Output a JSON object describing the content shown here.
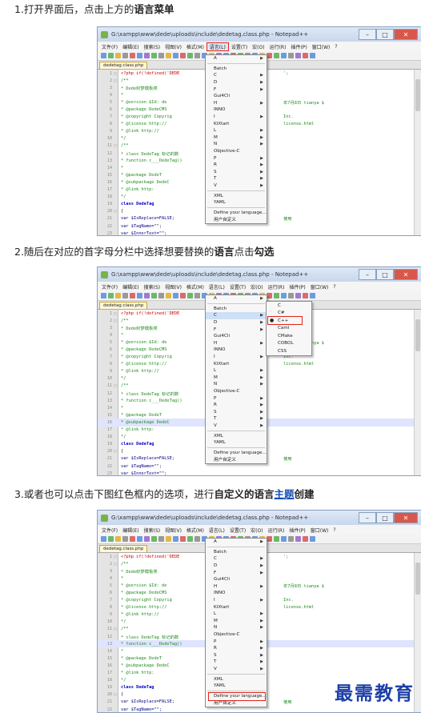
{
  "steps": [
    {
      "pre": "1.打开界面后，点击上方的",
      "bold1": "语言菜单",
      "mid": "",
      "bold2": "",
      "link": "",
      "tail": ""
    },
    {
      "pre": "2.随后在对应的首字母分栏中选择想要替换的",
      "bold1": "语言",
      "mid": "点击",
      "bold2": "勾选",
      "link": "",
      "tail": ""
    },
    {
      "pre": "3.或者也可以点击下图红色框内的选项，进行",
      "bold1": "自定义的语言",
      "mid": "",
      "bold2": "",
      "link": "主题",
      "tail": "创建"
    }
  ],
  "window": {
    "title": "G:\\xampp\\www\\dede\\uploads\\include\\dedetag.class.php - Notepad++",
    "close": "✕",
    "maximize": "□",
    "minimize": "–",
    "menus": [
      "文件(F)",
      "编辑(E)",
      "搜索(S)",
      "视图(V)",
      "格式(M)",
      "语言(L)",
      "设置(T)",
      "宏(O)",
      "运行(R)",
      "插件(P)",
      "窗口(W)",
      "?"
    ],
    "tab": "dedetag.class.php"
  },
  "code": [
    {
      "n": "1",
      "f": "□",
      "t": "<?php   if(!defined('DEDE"
    },
    {
      "n": "2",
      "f": "□",
      "t": "/**"
    },
    {
      "n": "3",
      "f": "",
      "t": " * Dede织梦模板类"
    },
    {
      "n": "4",
      "f": "",
      "t": " *"
    },
    {
      "n": "5",
      "f": "",
      "t": " * @version        $Id: de"
    },
    {
      "n": "6",
      "f": "",
      "t": " * @package        DedeCMS"
    },
    {
      "n": "7",
      "f": "",
      "t": " * @copyright      Copyrig"
    },
    {
      "n": "8",
      "f": "",
      "t": " * @license        http://"
    },
    {
      "n": "9",
      "f": "",
      "t": " * @link           http://"
    },
    {
      "n": "10",
      "f": "",
      "t": " */"
    },
    {
      "n": "11",
      "f": "□",
      "t": "/**"
    },
    {
      "n": "12",
      "f": "",
      "t": " * class DedeTag 标记的数"
    },
    {
      "n": "13",
      "f": "",
      "t": " * function c___DedeTag()"
    },
    {
      "n": "14",
      "f": "",
      "t": " *"
    },
    {
      "n": "15",
      "f": "",
      "t": " * @package        DedeT"
    },
    {
      "n": "16",
      "f": "",
      "t": " * @subpackage     DedeC"
    },
    {
      "n": "17",
      "f": "",
      "t": " * @link           http:"
    },
    {
      "n": "18",
      "f": "",
      "t": " */"
    },
    {
      "n": "19",
      "f": "",
      "t": "class DedeTag"
    },
    {
      "n": "20",
      "f": "□",
      "t": "{"
    },
    {
      "n": "21",
      "f": "",
      "t": "    var $IsReplace=FALSE;"
    },
    {
      "n": "22",
      "f": "",
      "t": "    var $TagName=\"\";"
    },
    {
      "n": "23",
      "f": "",
      "t": "    var $InnerText=\"\";"
    },
    {
      "n": "24",
      "f": "",
      "t": "    var $StartPos=0;"
    },
    {
      "n": "25",
      "f": "",
      "t": "    var $EndPos=0;"
    },
    {
      "n": "26",
      "f": "",
      "t": "    var $CAttribute=\"\";"
    },
    {
      "n": "27",
      "f": "",
      "t": "    var $TagValue=\"\";"
    },
    {
      "n": "28",
      "f": "",
      "t": "    var $TagID = 0;"
    }
  ],
  "right_code": {
    "line1": "';",
    "line5": "年7月8日 tianya $",
    "line7": "Inc.",
    "line8": "license.html",
    "line21": "使用",
    "line26": "eAttribute",
    "line27": "//标记的值"
  },
  "language_menu": {
    "items": [
      "A",
      "Batch",
      "C",
      "D",
      "F",
      "Gui4Cli",
      "H",
      "INNO",
      "I",
      "KIXtart",
      "L",
      "M",
      "N",
      "Objective-C",
      "P",
      "R",
      "S",
      "T",
      "V",
      "XML",
      "YAML"
    ],
    "has_arrow": [
      true,
      false,
      true,
      true,
      true,
      false,
      true,
      false,
      true,
      false,
      true,
      true,
      true,
      false,
      true,
      true,
      true,
      true,
      true,
      false,
      false
    ],
    "define": "Define your language...",
    "user_defined": "用户自定义"
  },
  "c_submenu": {
    "items": [
      "C",
      "C#",
      "C++",
      "Caml",
      "CMake",
      "COBOL",
      "CSS"
    ],
    "checked_index": 2,
    "check": "●"
  },
  "watermark": "最需教育"
}
